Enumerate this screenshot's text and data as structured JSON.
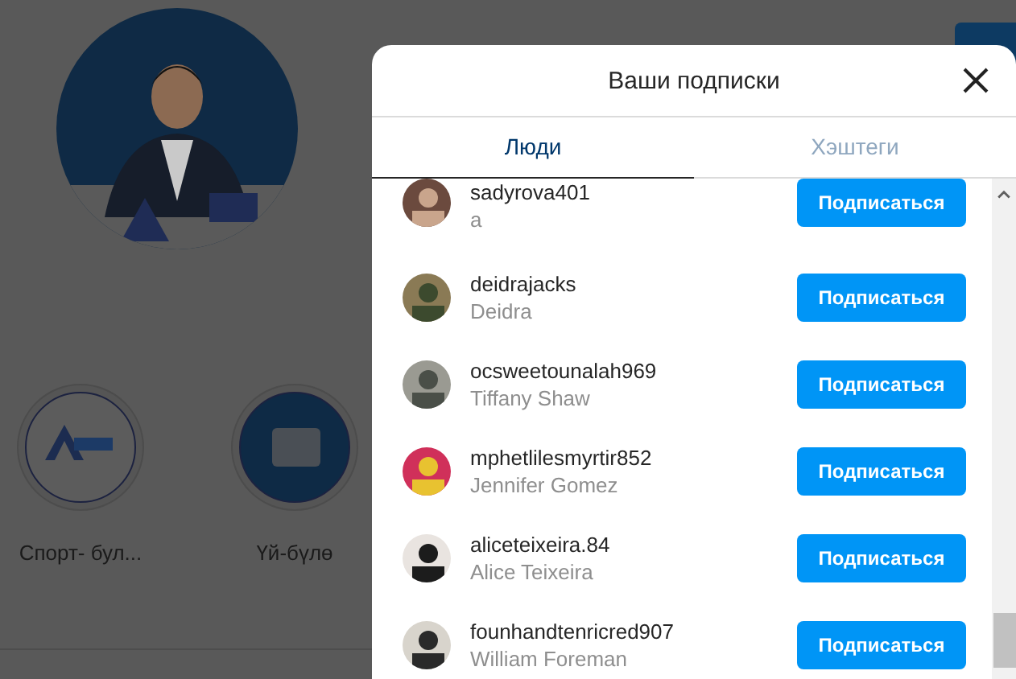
{
  "highlights": [
    {
      "label": "Спорт- бул..."
    },
    {
      "label": "Үй-бүлө"
    }
  ],
  "modal": {
    "title": "Ваши подписки",
    "tabs": [
      {
        "label": "Люди",
        "selected": true
      },
      {
        "label": "Хэштеги",
        "selected": false
      }
    ],
    "accounts": [
      {
        "username": "sadyrova401",
        "name": "a",
        "button": "Подписаться"
      },
      {
        "username": "deidrajacks",
        "name": "Deidra",
        "button": "Подписаться"
      },
      {
        "username": "ocsweetounalah969",
        "name": "Tiffany Shaw",
        "button": "Подписаться"
      },
      {
        "username": "mphetlilesmyrtir852",
        "name": "Jennifer Gomez",
        "button": "Подписаться"
      },
      {
        "username": "aliceteixeira.84",
        "name": "Alice Teixeira",
        "button": "Подписаться"
      },
      {
        "username": "founhandtenricred907",
        "name": "William Foreman",
        "button": "Подписаться"
      }
    ]
  }
}
